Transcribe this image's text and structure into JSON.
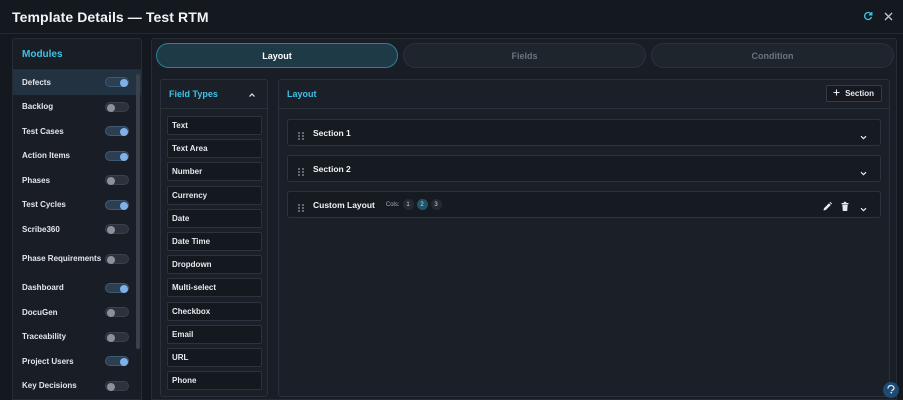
{
  "window": {
    "title": "Template Details — Test RTM",
    "icons": [
      "refresh-icon",
      "close-icon"
    ]
  },
  "sidebar": {
    "header": "Modules",
    "items": [
      {
        "label": "Defects",
        "enabled": true,
        "active": true
      },
      {
        "label": "Backlog",
        "enabled": false
      },
      {
        "label": "Test Cases",
        "enabled": true
      },
      {
        "label": "Action Items",
        "enabled": true
      },
      {
        "label": "Phases",
        "enabled": false
      },
      {
        "label": "Test Cycles",
        "enabled": true
      },
      {
        "label": "Scribe360",
        "enabled": false
      },
      {
        "label": "Phase Requirements",
        "enabled": false
      },
      {
        "label": "Dashboard",
        "enabled": true
      },
      {
        "label": "DocuGen",
        "enabled": false
      },
      {
        "label": "Traceability",
        "enabled": false
      },
      {
        "label": "Project Users",
        "enabled": true
      },
      {
        "label": "Key Decisions",
        "enabled": false
      }
    ]
  },
  "tabs": [
    {
      "label": "Layout",
      "active": true
    },
    {
      "label": "Fields",
      "active": false
    },
    {
      "label": "Condition",
      "active": false
    }
  ],
  "field_types": {
    "header": "Field Types",
    "items": [
      "Text",
      "Text Area",
      "Number",
      "Currency",
      "Date",
      "Date Time",
      "Dropdown",
      "Multi-select",
      "Checkbox",
      "Email",
      "URL",
      "Phone"
    ]
  },
  "layout": {
    "header": "Layout",
    "add_section_label": "Section",
    "sections": [
      {
        "title": "Section 1"
      },
      {
        "title": "Section 2"
      },
      {
        "title": "Custom Layout",
        "cols_label": "Cols:",
        "cols": [
          "1",
          "2",
          "3"
        ],
        "selected_col": "2"
      }
    ]
  },
  "colors": {
    "accent": "#3ec1e6",
    "background": "#14181f",
    "panel": "#191e26",
    "toggle_on": "#7fb1e8"
  }
}
